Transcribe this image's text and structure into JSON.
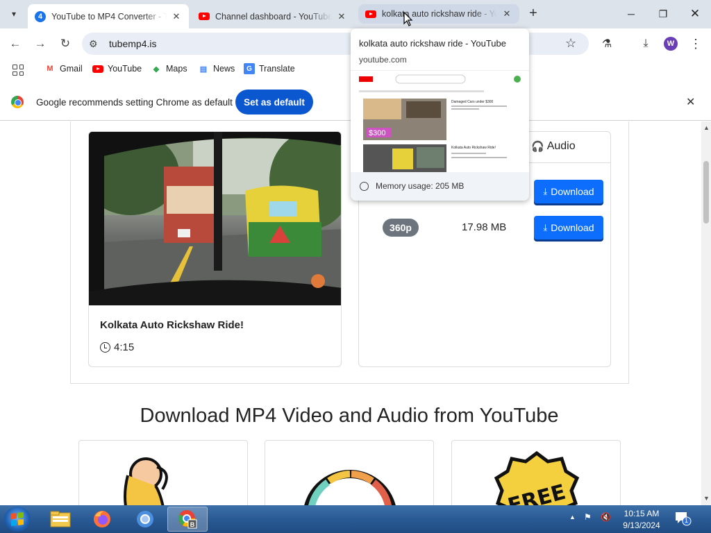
{
  "tabs": [
    {
      "title": "YouTube to MP4 Converter - Tu",
      "favicon": "number-4-icon"
    },
    {
      "title": "Channel dashboard - YouTube S",
      "favicon": "youtube-icon"
    },
    {
      "title": "kolkata auto rickshaw ride - You",
      "favicon": "youtube-icon"
    }
  ],
  "toolbar": {
    "url": "tubemp4.is",
    "profile_initial": "W"
  },
  "bookmarks": [
    {
      "label": "Gmail",
      "icon": "gmail-icon"
    },
    {
      "label": "YouTube",
      "icon": "youtube-icon"
    },
    {
      "label": "Maps",
      "icon": "maps-icon"
    },
    {
      "label": "News",
      "icon": "news-icon"
    },
    {
      "label": "Translate",
      "icon": "translate-icon"
    }
  ],
  "infobar": {
    "message": "Google recommends setting Chrome as default",
    "button": "Set as default"
  },
  "hovercard": {
    "title": "kolkata auto rickshaw ride - YouTube",
    "domain": "youtube.com",
    "memory": "Memory usage: 205 MB",
    "preview_price": "$300",
    "preview_item1": "Damaged Cars under $300",
    "preview_item2": "Kolkata Auto Rickshaw Ride!"
  },
  "video": {
    "title": "Kolkata Auto Rickshaw Ride!",
    "duration": "4:15"
  },
  "downloads": {
    "audio_tab": "Audio",
    "rows": [
      {
        "quality": "",
        "size": "",
        "button": "Download"
      },
      {
        "quality": "360p",
        "size": "17.98 MB",
        "button": "Download"
      }
    ]
  },
  "section": {
    "heading": "Download MP4 Video and Audio from YouTube"
  },
  "taskbar": {
    "time": "10:15 AM",
    "date": "9/13/2024",
    "notification_count": "1"
  },
  "colors": {
    "primary_button": "#0d6efd",
    "chrome_blue": "#0b57d0",
    "quality_badge": "#6c757d"
  }
}
